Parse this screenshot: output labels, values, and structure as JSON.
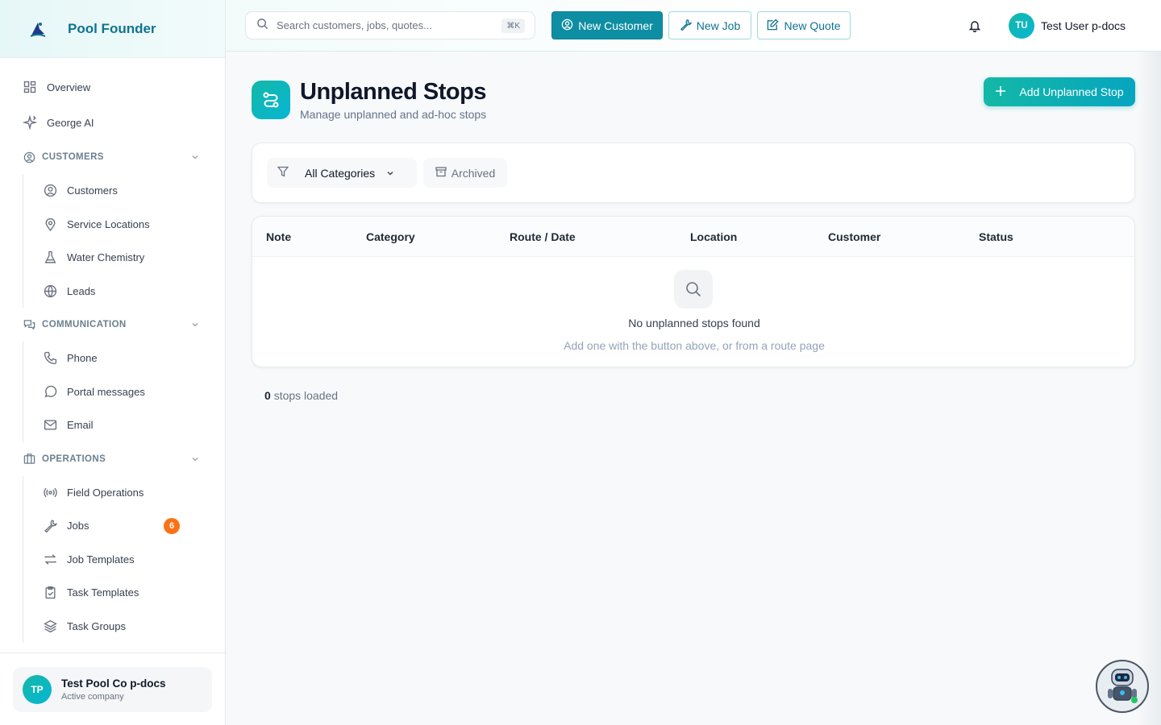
{
  "brand": {
    "name": "Pool Founder"
  },
  "sidebar": {
    "top_items": [
      {
        "label": "Overview",
        "icon": "grid-icon"
      },
      {
        "label": "George AI",
        "icon": "sparkles-icon"
      }
    ],
    "sections": [
      {
        "title": "CUSTOMERS",
        "icon": "user-circle-icon",
        "items": [
          {
            "label": "Customers",
            "icon": "user-circle-icon"
          },
          {
            "label": "Service Locations",
            "icon": "map-pin-icon"
          },
          {
            "label": "Water Chemistry",
            "icon": "flask-icon"
          },
          {
            "label": "Leads",
            "icon": "globe-icon"
          }
        ]
      },
      {
        "title": "COMMUNICATION",
        "icon": "chat-icon",
        "items": [
          {
            "label": "Phone",
            "icon": "phone-icon"
          },
          {
            "label": "Portal messages",
            "icon": "message-circle-icon"
          },
          {
            "label": "Email",
            "icon": "mail-icon"
          }
        ]
      },
      {
        "title": "OPERATIONS",
        "icon": "building-icon",
        "items": [
          {
            "label": "Field Operations",
            "icon": "radio-icon"
          },
          {
            "label": "Jobs",
            "icon": "wrench-icon",
            "badge": "6"
          },
          {
            "label": "Job Templates",
            "icon": "repeat-icon"
          },
          {
            "label": "Task Templates",
            "icon": "clipboard-check-icon"
          },
          {
            "label": "Task Groups",
            "icon": "layers-icon"
          }
        ]
      }
    ],
    "company": {
      "initials": "TP",
      "name": "Test Pool Co p-docs",
      "status": "Active company"
    }
  },
  "topbar": {
    "search_placeholder": "Search customers, jobs, quotes...",
    "search_shortcut": "⌘K",
    "new_customer": "New Customer",
    "new_job": "New Job",
    "new_quote": "New Quote",
    "user_initials": "TU",
    "user_name": "Test User p-docs"
  },
  "page": {
    "title": "Unplanned Stops",
    "subtitle": "Manage unplanned and ad-hoc stops",
    "add_button": "Add Unplanned Stop"
  },
  "filters": {
    "category_selected": "All Categories",
    "archived_label": "Archived"
  },
  "table": {
    "columns": [
      "Note",
      "Category",
      "Route / Date",
      "Location",
      "Customer",
      "Status"
    ],
    "empty_title": "No unplanned stops found",
    "empty_subtitle": "Add one with the button above, or from a route page"
  },
  "footer": {
    "count": "0",
    "count_label": "stops loaded"
  },
  "colors": {
    "accent": "#0e8ea2",
    "accent_gradient_start": "#14b8a6",
    "badge": "#f97316"
  }
}
